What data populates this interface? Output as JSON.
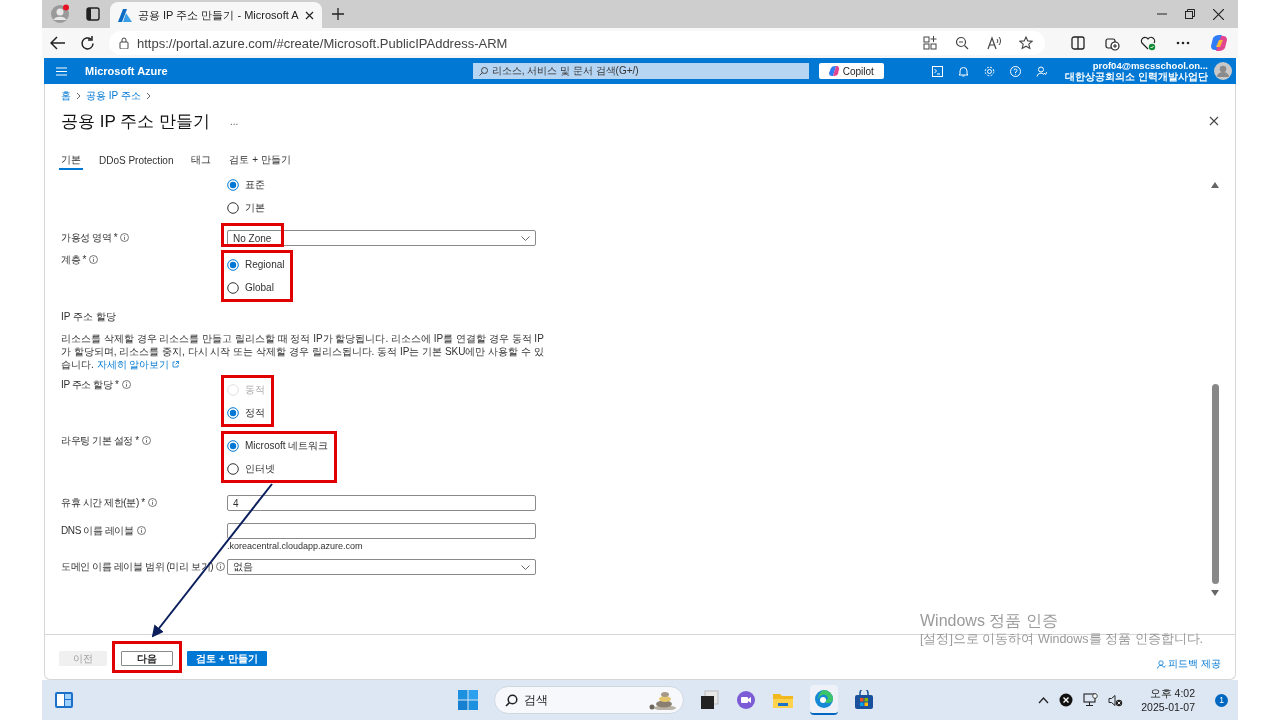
{
  "browser": {
    "tab_title": "공용 IP 주소 만들기 - Microsoft A",
    "url": "https://portal.azure.com/#create/Microsoft.PublicIPAddress-ARM"
  },
  "portal": {
    "brand": "Microsoft Azure",
    "search_placeholder": "리소스, 서비스 및 문서 검색(G+/)",
    "copilot": "Copilot",
    "account_email": "prof04@mscsschool.on...",
    "account_org": "대한상공회의소 인력개발사업단"
  },
  "breadcrumb": [
    "홈",
    "공용 IP 주소"
  ],
  "title": "공용 IP 주소 만들기",
  "more": "...",
  "tabs": [
    {
      "label": "기본",
      "selected": true
    },
    {
      "label": "DDoS Protection",
      "selected": false
    },
    {
      "label": "태그",
      "selected": false
    },
    {
      "label": "검토 + 만들기",
      "selected": false
    }
  ],
  "form": [
    {
      "kind": "radio",
      "highlighted": false,
      "options": [
        {
          "label": "표준",
          "selected": true,
          "disabled": false
        },
        {
          "label": "기본",
          "selected": false,
          "disabled": false
        }
      ]
    },
    {
      "kind": "select",
      "label": "가용성 영역 *",
      "info": true,
      "value": "No Zone",
      "highlighted": true
    },
    {
      "kind": "radio",
      "label": "계층 *",
      "info": true,
      "highlighted": true,
      "options": [
        {
          "label": "Regional",
          "selected": true,
          "disabled": false
        },
        {
          "label": "Global",
          "selected": false,
          "disabled": false
        }
      ]
    },
    {
      "kind": "section",
      "heading": "IP 주소 할당",
      "text": "리소스를 삭제할 경우 리소스를 만들고 릴리스할 때 정적 IP가 할당됩니다. 리소스에 IP를 연결할 경우 동적 IP가 할당되며, 리소스를 중지, 다시 시작 또는 삭제할 경우 릴리스됩니다. 동적 IP는 기본 SKU에만 사용할 수 있습니다.",
      "link": "자세히 알아보기"
    },
    {
      "kind": "radio",
      "label": "IP 주소 할당 *",
      "info": true,
      "highlighted": true,
      "options": [
        {
          "label": "동적",
          "selected": false,
          "disabled": true
        },
        {
          "label": "정적",
          "selected": true,
          "disabled": false
        }
      ]
    },
    {
      "kind": "radio",
      "label": "라우팅 기본 설정 *",
      "info": true,
      "highlighted": true,
      "options": [
        {
          "label": "Microsoft 네트워크",
          "selected": true,
          "disabled": false
        },
        {
          "label": "인터넷",
          "selected": false,
          "disabled": false
        }
      ]
    },
    {
      "kind": "text",
      "label": "유휴 시간 제한(분) *",
      "info": true,
      "value": "4",
      "highlighted": false
    },
    {
      "kind": "text",
      "label": "DNS 이름 레이블",
      "info": true,
      "hint": ".koreacentral.cloudapp.azure.com",
      "highlighted": false
    },
    {
      "kind": "select",
      "label": "도메인 이름 레이블 범위 (미리 보기)",
      "info": true,
      "value": "없음",
      "highlighted": false
    }
  ],
  "footer": {
    "buttons": [
      {
        "label": "이전",
        "kind": "disabled",
        "highlighted": false
      },
      {
        "label": "다음",
        "kind": "secondary",
        "highlighted": true
      },
      {
        "label": "검토 + 만들기",
        "kind": "primary",
        "highlighted": false
      }
    ],
    "feedback": "피드백 제공"
  },
  "annotation_arrow": true,
  "watermark": {
    "title": "Windows 정품 인증",
    "text": "[설정]으로 이동하여 Windows를 정품 인증합니다."
  },
  "taskbar": {
    "search": "검색",
    "time": "오후 4:02",
    "date": "2025-01-07",
    "notifications": "1"
  }
}
